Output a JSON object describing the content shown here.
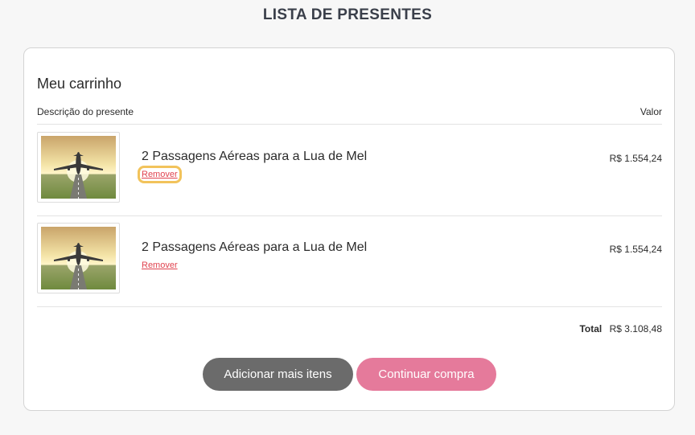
{
  "page": {
    "title": "LISTA DE PRESENTES"
  },
  "cart": {
    "heading": "Meu carrinho",
    "columns": {
      "description": "Descrição do presente",
      "value": "Valor"
    },
    "items": [
      {
        "name": "2 Passagens Aéreas para a Lua de Mel",
        "price": "R$ 1.554,24",
        "remove_label": "Remover",
        "image_icon": "airplane-photo"
      },
      {
        "name": "2 Passagens Aéreas para a Lua de Mel",
        "price": "R$ 1.554,24",
        "remove_label": "Remover",
        "image_icon": "airplane-photo"
      }
    ],
    "total_label": "Total",
    "total_value": "R$ 3.108,48"
  },
  "actions": {
    "add_more": "Adicionar mais itens",
    "continue": "Continuar compra"
  },
  "colors": {
    "accent_pink": "#e57a9b",
    "button_gray": "#6b6b6b",
    "remove_red": "#e0424e",
    "highlight": "#f2c35b"
  }
}
